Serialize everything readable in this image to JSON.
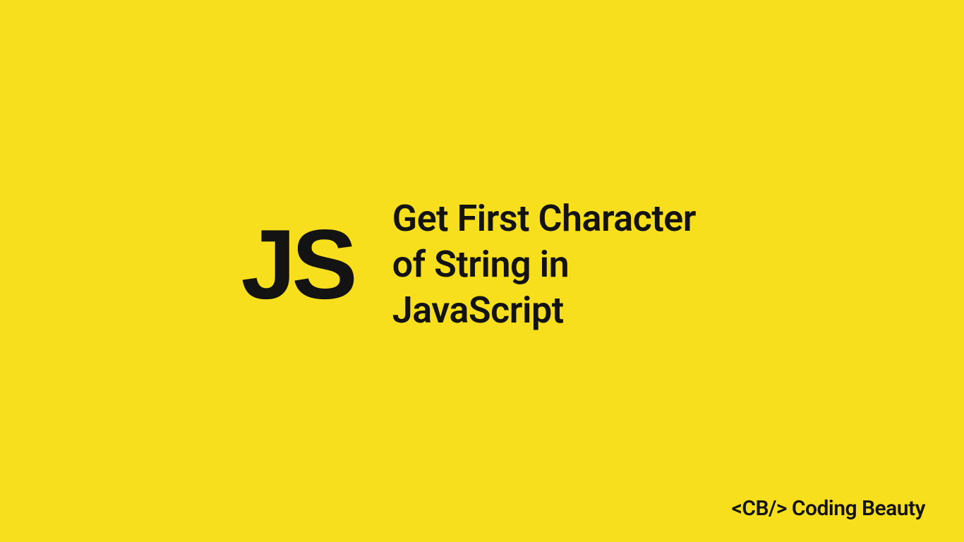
{
  "logo": {
    "text": "JS"
  },
  "title": {
    "text": "Get First Character of String in JavaScript"
  },
  "brand": {
    "text": "<CB/> Coding Beauty"
  }
}
